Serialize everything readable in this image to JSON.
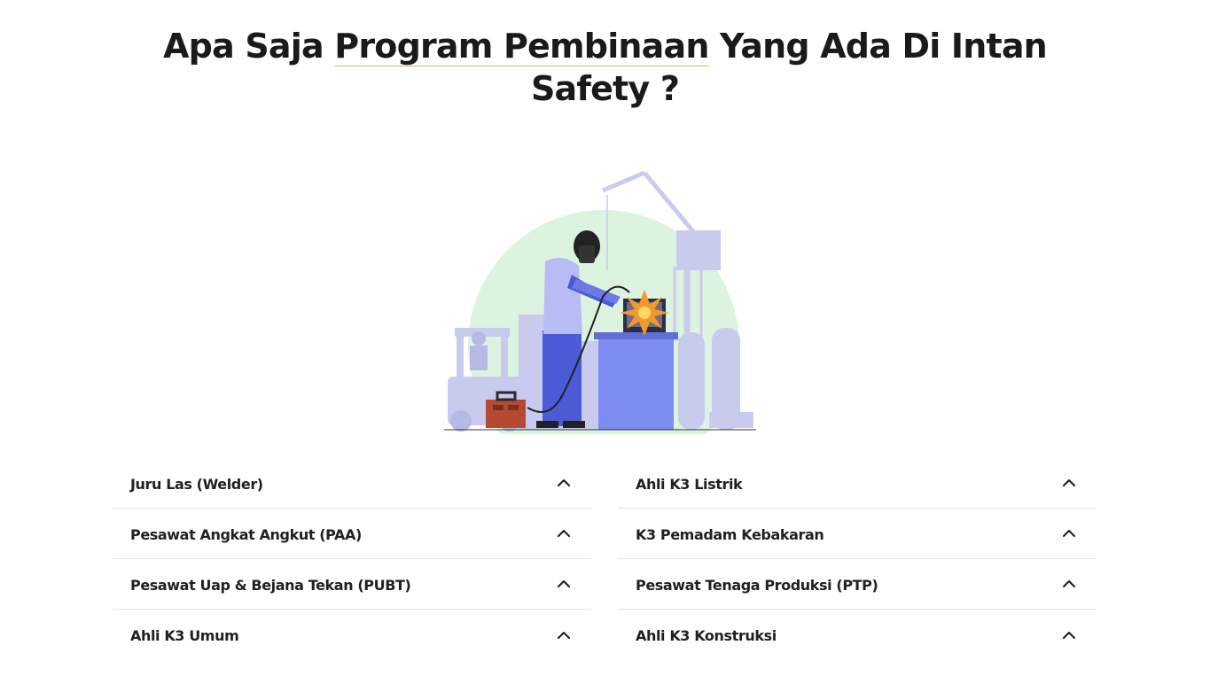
{
  "heading": {
    "part1": "Apa Saja ",
    "highlight": "Program Pembinaan",
    "part2": " Yang Ada Di Intan",
    "line2": "Safety ?"
  },
  "illustration": {
    "icon": "welder-illustration",
    "colors": {
      "circle": "#dcf3e0",
      "machinery": "#c9cbee",
      "table": "#7c8cf0",
      "toolbox": "#b44a32",
      "spark": "#f59a2a"
    }
  },
  "faq_left": [
    {
      "title": "Juru Las (Welder)",
      "icon": "chevron-up-icon"
    },
    {
      "title": "Pesawat Angkat Angkut (PAA)",
      "icon": "chevron-up-icon"
    },
    {
      "title": "Pesawat Uap & Bejana Tekan (PUBT)",
      "icon": "chevron-up-icon"
    },
    {
      "title": "Ahli K3 Umum",
      "icon": "chevron-up-icon"
    }
  ],
  "faq_right": [
    {
      "title": "Ahli K3 Listrik",
      "icon": "chevron-up-icon"
    },
    {
      "title": "K3 Pemadam Kebakaran",
      "icon": "chevron-up-icon"
    },
    {
      "title": "Pesawat Tenaga Produksi (PTP)",
      "icon": "chevron-up-icon"
    },
    {
      "title": "Ahli K3 Konstruksi",
      "icon": "chevron-up-icon"
    }
  ]
}
